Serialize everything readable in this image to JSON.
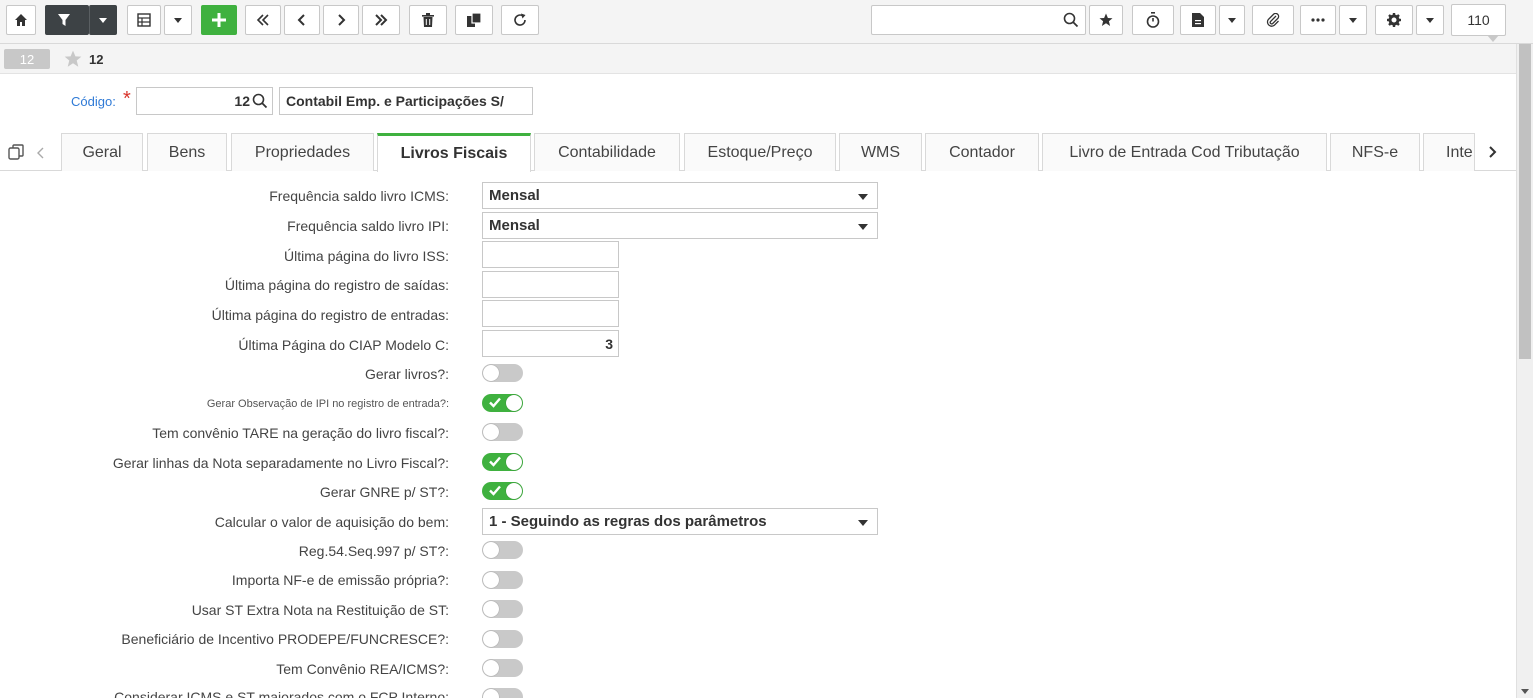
{
  "toolbar": {
    "icons": [
      "home-icon",
      "filter-icon",
      "grid-icon",
      "plus-icon",
      "first-icon",
      "prev-icon",
      "next-icon",
      "last-icon",
      "trash-icon",
      "copy-icon",
      "refresh-icon",
      "search-icon",
      "star-icon",
      "timer-icon",
      "report-icon",
      "clip-icon",
      "more-icon",
      "gear-icon"
    ],
    "search_value": "",
    "zoom": "110"
  },
  "record": {
    "badge": "12",
    "number": "12"
  },
  "codigo": {
    "label": "Código:",
    "required_mark": "*",
    "value": "12",
    "name": "Contabil Emp. e Participações S/"
  },
  "tabs": [
    {
      "label": "Geral"
    },
    {
      "label": "Bens"
    },
    {
      "label": "Propriedades"
    },
    {
      "label": "Livros Fiscais",
      "active": true
    },
    {
      "label": "Contabilidade"
    },
    {
      "label": "Estoque/Preço"
    },
    {
      "label": "WMS"
    },
    {
      "label": "Contador"
    },
    {
      "label": "Livro de Entrada Cod Tributação"
    },
    {
      "label": "NFS-e"
    },
    {
      "label": "Inte"
    }
  ],
  "form": {
    "freq_icms": {
      "label": "Frequência saldo livro ICMS:",
      "value": "Mensal"
    },
    "freq_ipi": {
      "label": "Frequência saldo livro IPI:",
      "value": "Mensal"
    },
    "ult_iss": {
      "label": "Última página do livro ISS:",
      "value": ""
    },
    "ult_saidas": {
      "label": "Última página do registro de saídas:",
      "value": ""
    },
    "ult_entradas": {
      "label": "Última página do registro de entradas:",
      "value": ""
    },
    "ult_ciap": {
      "label": "Última Página do CIAP Modelo C:",
      "value": "3"
    },
    "gerar_livros": {
      "label": "Gerar livros?:",
      "on": false
    },
    "gerar_obs_ipi": {
      "label": "Gerar Observação de IPI no registro de entrada?:",
      "on": true
    },
    "tare": {
      "label": "Tem convênio TARE na geração do livro fiscal?:",
      "on": false
    },
    "linhas_nota": {
      "label": "Gerar linhas da Nota separadamente no Livro Fiscal?:",
      "on": true
    },
    "gnre": {
      "label": "Gerar GNRE p/ ST?:",
      "on": true
    },
    "calc_aquisicao": {
      "label": "Calcular o valor de aquisição do bem:",
      "value": "1 - Seguindo as regras dos parâmetros"
    },
    "reg54": {
      "label": "Reg.54.Seq.997 p/ ST?:",
      "on": false
    },
    "importa_nfe": {
      "label": "Importa NF-e de emissão própria?:",
      "on": false
    },
    "st_extra": {
      "label": "Usar ST Extra Nota na Restituição de ST:",
      "on": false
    },
    "prodepe": {
      "label": "Beneficiário de Incentivo PRODEPE/FUNCRESCE?:",
      "on": false
    },
    "rea_icms": {
      "label": "Tem Convênio REA/ICMS?:",
      "on": false
    },
    "icms_st_fcp": {
      "label": "Considerar ICMS e ST majorados com o FCP Interno:",
      "on": false
    }
  },
  "colors": {
    "accent_green": "#3fb13f",
    "dark_button": "#3d4245",
    "link_blue": "#2f7ad6",
    "required_red": "#d9342b"
  }
}
